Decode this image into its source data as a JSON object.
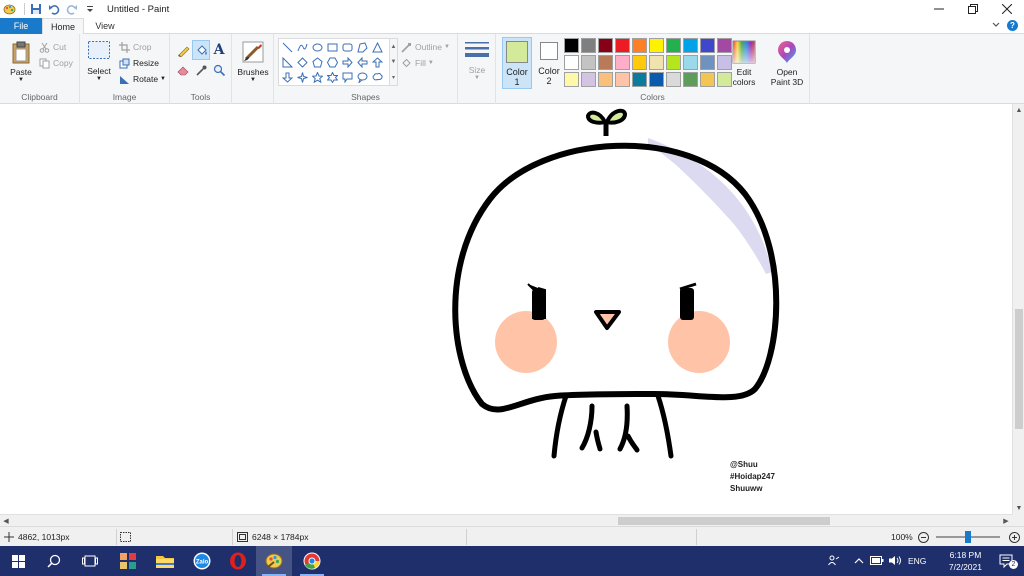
{
  "window": {
    "title": "Untitled - Paint",
    "controls": [
      "minimize",
      "restore",
      "close"
    ]
  },
  "tabs": {
    "file": "File",
    "home": "Home",
    "view": "View"
  },
  "ribbon": {
    "clipboard": {
      "paste": "Paste",
      "cut": "Cut",
      "copy": "Copy",
      "label": "Clipboard"
    },
    "image": {
      "select": "Select",
      "crop": "Crop",
      "resize": "Resize",
      "rotate": "Rotate",
      "label": "Image"
    },
    "tools": {
      "label": "Tools",
      "selected_tool": "fill-icon"
    },
    "brushes": {
      "label": "Brushes"
    },
    "shapes": {
      "outline": "Outline",
      "fill": "Fill",
      "label": "Shapes"
    },
    "size": {
      "label": "Size"
    },
    "colors": {
      "color1_line1": "Color",
      "color1_line2": "1",
      "color2_line1": "Color",
      "color2_line2": "2",
      "color1_value": "#d4ea9b",
      "color2_value": "#ffffff",
      "edit_line1": "Edit",
      "edit_line2": "colors",
      "label": "Colors",
      "palette": [
        "#000000",
        "#7f7f7f",
        "#880015",
        "#ed1c24",
        "#ff7f27",
        "#fff200",
        "#22b14c",
        "#00a2e8",
        "#3f48cc",
        "#a349a4",
        "#ffffff",
        "#c3c3c3",
        "#b97a57",
        "#ffaec9",
        "#ffc90e",
        "#efe4b0",
        "#b5e61d",
        "#99d9ea",
        "#7092be",
        "#c8bfe7",
        "#fff8a8",
        "#d4c4e4",
        "#f9c07c",
        "#ffc3a8",
        "#0c7c9e",
        "#0a5aad",
        "#dadada",
        "#5e9c5a",
        "#f3c553",
        "#d4ea9b"
      ]
    },
    "paint3d": {
      "line1": "Open",
      "line2": "Paint 3D"
    }
  },
  "artwork": {
    "signature": [
      "@Shuu",
      "#Hoidap247",
      "Shuuww"
    ]
  },
  "statusbar": {
    "cursor_position": "4862, 1013px",
    "image_size": "6248 × 1784px",
    "zoom": "100%"
  },
  "taskbar": {
    "language": "ENG",
    "time": "6:18 PM",
    "date": "7/2/2021"
  }
}
